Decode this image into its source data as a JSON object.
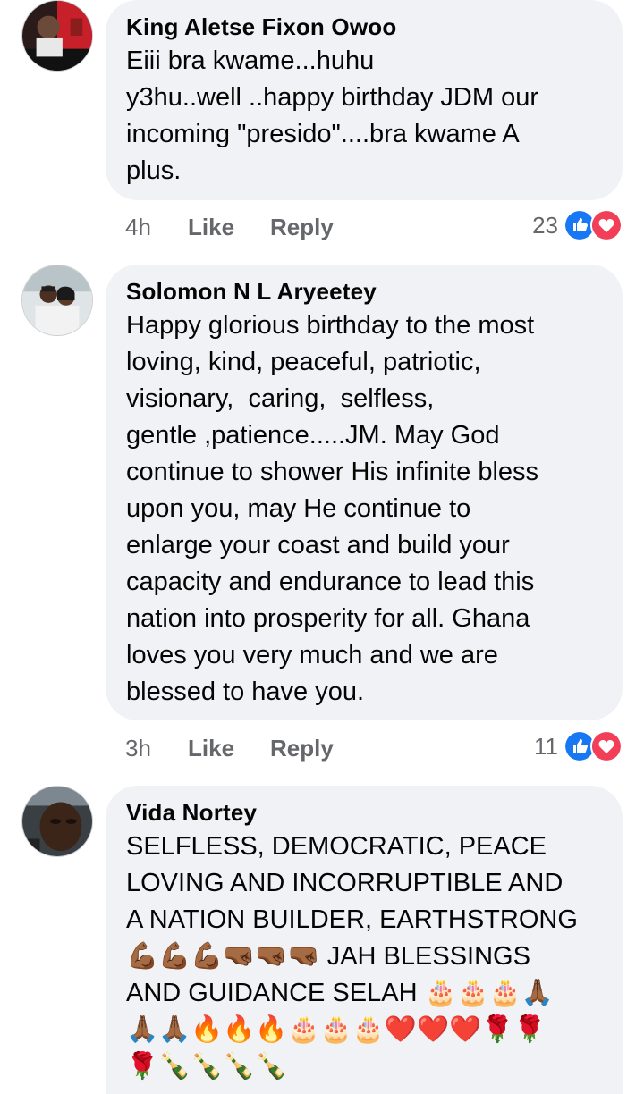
{
  "comments": [
    {
      "author": "King Aletse Fixon Owoo",
      "text": "Eiii bra kwame...huhu\ny3hu..well ..happy birthday JDM our\nincoming \"presido\"....bra kwame A\nplus.",
      "time": "4h",
      "like_label": "Like",
      "reply_label": "Reply",
      "reaction_count": "23",
      "reactions": [
        "like-icon",
        "love-icon"
      ]
    },
    {
      "author": "Solomon N L Aryeetey",
      "text": "Happy glorious birthday to the most\nloving, kind, peaceful, patriotic,\nvisionary,  caring,  selfless,\ngentle ,patience.....JM. May God\ncontinue to shower His infinite bless\nupon you, may He continue to\nenlarge your coast and build your\ncapacity and endurance to lead this\nnation into prosperity for all. Ghana\nloves you very much and we are\nblessed to have you.",
      "time": "3h",
      "like_label": "Like",
      "reply_label": "Reply",
      "reaction_count": "11",
      "reactions": [
        "like-icon",
        "love-icon"
      ]
    },
    {
      "author": "Vida Nortey",
      "text": "SELFLESS, DEMOCRATIC, PEACE\nLOVING AND INCORRUPTIBLE AND\nA NATION BUILDER, EARTHSTRONG\n💪🏾💪🏾💪🏾🤜🏾🤜🏾🤜🏾 JAH BLESSINGS\nAND GUIDANCE SELAH 🎂🎂🎂🙏🏾\n🙏🏾🙏🏾🔥🔥🔥🎂🎂🎂❤️❤️❤️🌹🌹\n🌹🍾🍾🍾🍾"
    }
  ],
  "colors": {
    "bubble_bg": "#f0f2f5",
    "meta_text": "#65676b",
    "like_blue": "#1877f2",
    "love_red": "#f33e58"
  }
}
